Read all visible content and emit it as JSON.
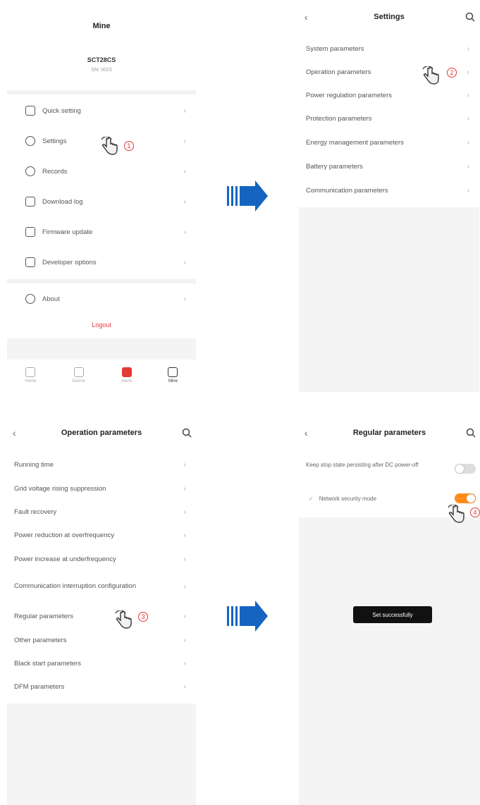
{
  "colors": {
    "accent_red": "#e53935",
    "toggle_on": "#ff8c1a",
    "arrow_blue": "#1565c0"
  },
  "screen1": {
    "title": "Mine",
    "device_model": "SCT28CS",
    "device_sn": "SN: 0023",
    "menu": [
      {
        "label": "Quick setting",
        "icon": "quick-setting-icon"
      },
      {
        "label": "Settings",
        "icon": "settings-icon"
      },
      {
        "label": "Records",
        "icon": "records-icon"
      },
      {
        "label": "Download log",
        "icon": "download-log-icon"
      },
      {
        "label": "Firmware update",
        "icon": "firmware-icon"
      },
      {
        "label": "Developer options",
        "icon": "developer-icon"
      }
    ],
    "about": "About",
    "logout": "Logout",
    "step": "1",
    "tabs": [
      "Home",
      "Device",
      "Alarm",
      "Mine"
    ]
  },
  "screen2": {
    "title": "Settings",
    "items": [
      "System parameters",
      "Operation parameters",
      "Power regulation parameters",
      "Protection parameters",
      "Energy management parameters",
      "Battery parameters",
      "Communication parameters"
    ],
    "step": "2"
  },
  "screen3": {
    "title": "Operation parameters",
    "items": [
      "Running time",
      "Grid voltage rising suppression",
      "Fault recovery",
      "Power reduction at overfrequency",
      "Power increase at underfrequency",
      "Communication interruption configuration",
      "Regular parameters",
      "Other parameters",
      "Black start parameters",
      "DFM parameters"
    ],
    "step": "3"
  },
  "screen4": {
    "title": "Regular parameters",
    "item1": "Keep stop state persisting after DC power-off",
    "item2": "Network security mode",
    "item2_check": "✓",
    "toast": "Set successfully",
    "step": "4"
  }
}
